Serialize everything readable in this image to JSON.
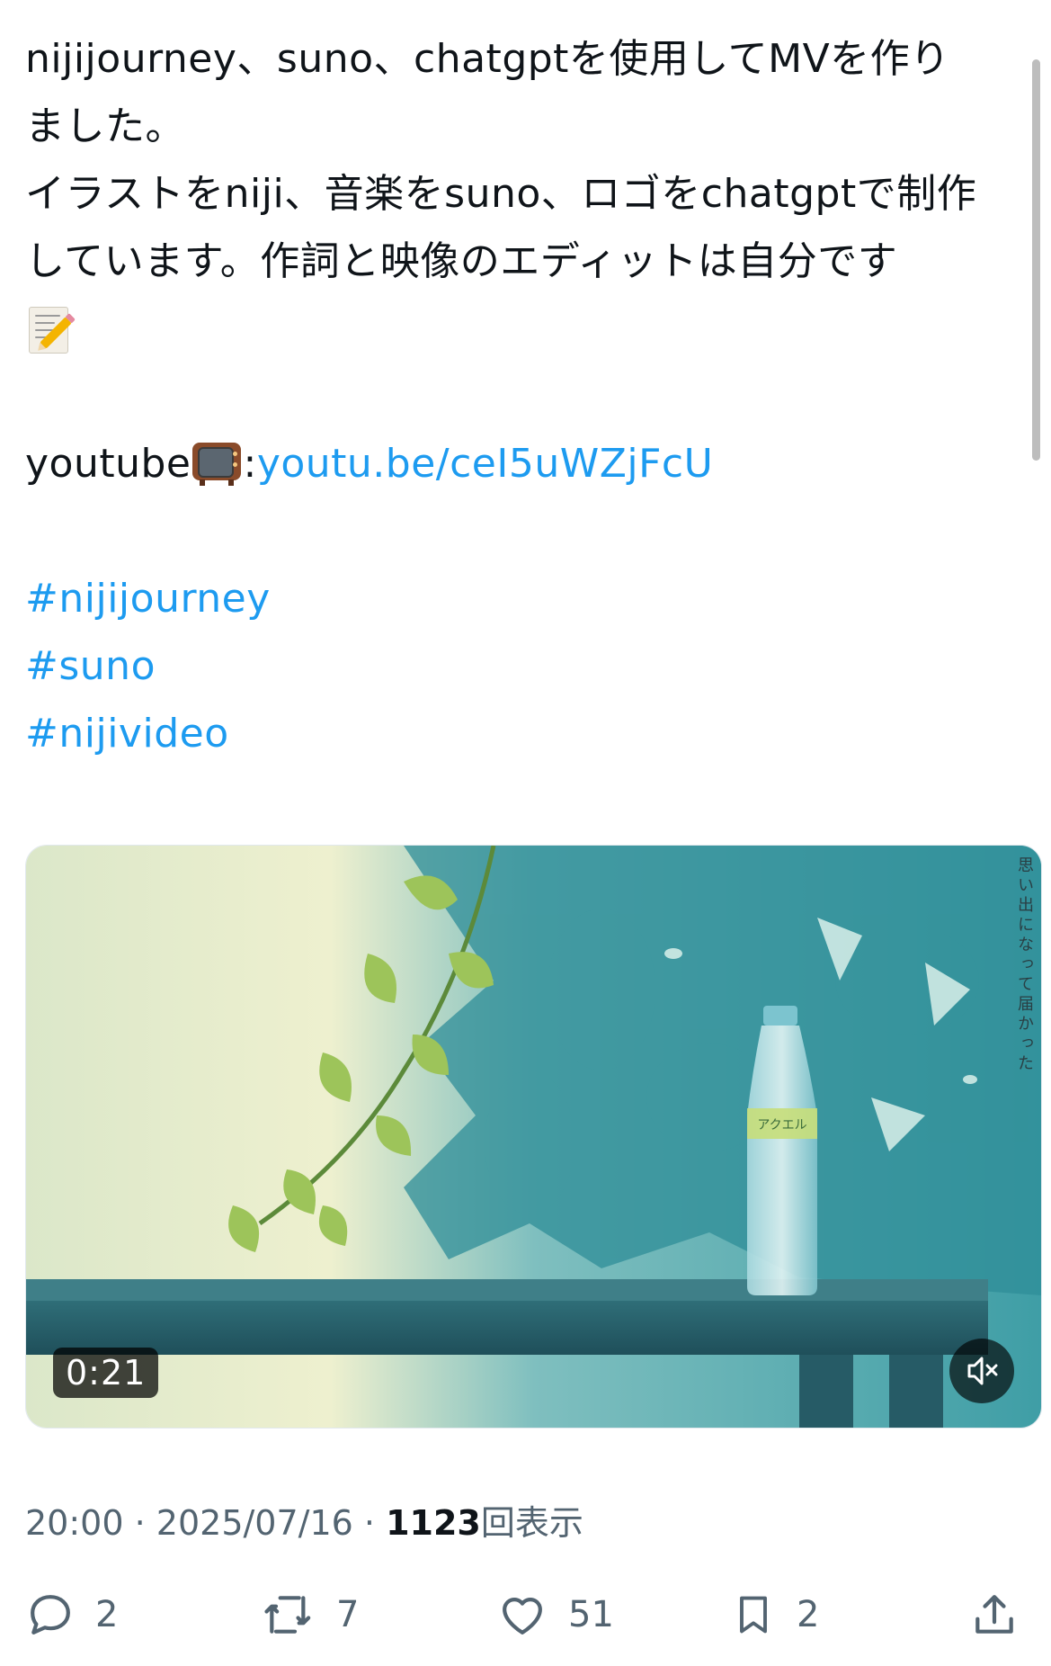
{
  "post": {
    "lines": [
      "nijijourney、suno、chatgptを使用してMVを作り",
      "ました。",
      "イラストをniji、音楽をsuno、ロゴをchatgptで制作",
      "しています。作詞と映像のエディットは自分です"
    ],
    "youtube_prefix": "youtube",
    "youtube_colon": ":",
    "youtube_link": "youtu.be/ceI5uWZjFcU",
    "hashtags": [
      "#nijijourney",
      "#suno",
      "#nijivideo"
    ]
  },
  "video": {
    "duration": "0:21",
    "side_caption": "思い出になって届かった",
    "bottle_label": "アクエル"
  },
  "meta": {
    "time": "20:00",
    "separator": "·",
    "date": "2025/07/16",
    "views": "1123",
    "views_label": "回表示"
  },
  "actions": {
    "replies": "2",
    "reposts": "7",
    "likes": "51",
    "bookmarks": "2"
  },
  "icons": [
    "memo-emoji-icon",
    "tv-emoji-icon",
    "mute-icon",
    "reply-icon",
    "repost-icon",
    "like-icon",
    "bookmark-icon",
    "share-icon"
  ],
  "colors": {
    "link": "#1d9bf0",
    "muted": "#536471",
    "text": "#0f1419"
  }
}
